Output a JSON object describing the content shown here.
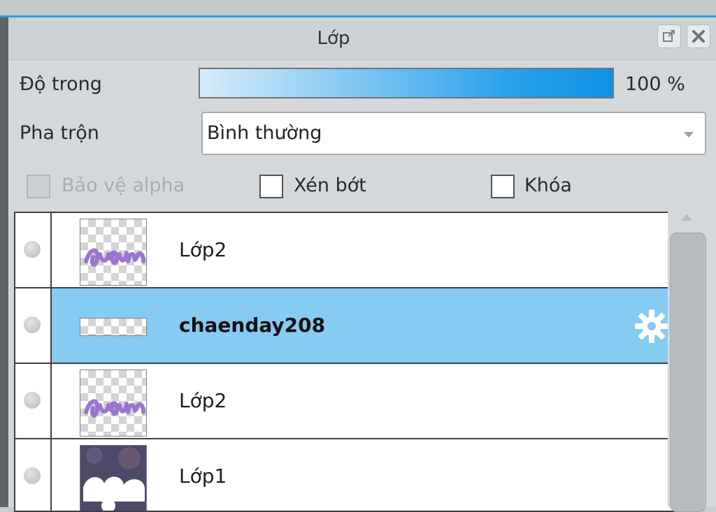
{
  "panel": {
    "title": "Lớp",
    "buttons": {
      "popout_icon": "popout-icon",
      "close_icon": "close-icon"
    }
  },
  "opacity": {
    "label": "Độ trong",
    "value_text": "100 %",
    "value": 100
  },
  "blend": {
    "label": "Pha trộn",
    "selected": "Bình thường"
  },
  "options": {
    "protect_alpha": {
      "label": "Bảo vệ alpha",
      "checked": false,
      "disabled": true
    },
    "clip": {
      "label": "Xén bớt",
      "checked": false
    },
    "lock": {
      "label": "Khóa",
      "checked": false
    }
  },
  "layers": [
    {
      "name": "Lớp2",
      "selected": false,
      "thumb": "thumbnail-script-text"
    },
    {
      "name": "chaenday208",
      "selected": true,
      "thumb": "thumbnail-text-strip",
      "icon": "settings-gear-icon"
    },
    {
      "name": "Lớp2",
      "selected": false,
      "thumb": "thumbnail-script-text"
    },
    {
      "name": "Lớp1",
      "selected": false,
      "thumb": "thumbnail-photo"
    }
  ],
  "colors": {
    "accent": "#2f9ee0",
    "selected_row": "#86cbf1",
    "opacity_fill": "#0f92e6"
  }
}
